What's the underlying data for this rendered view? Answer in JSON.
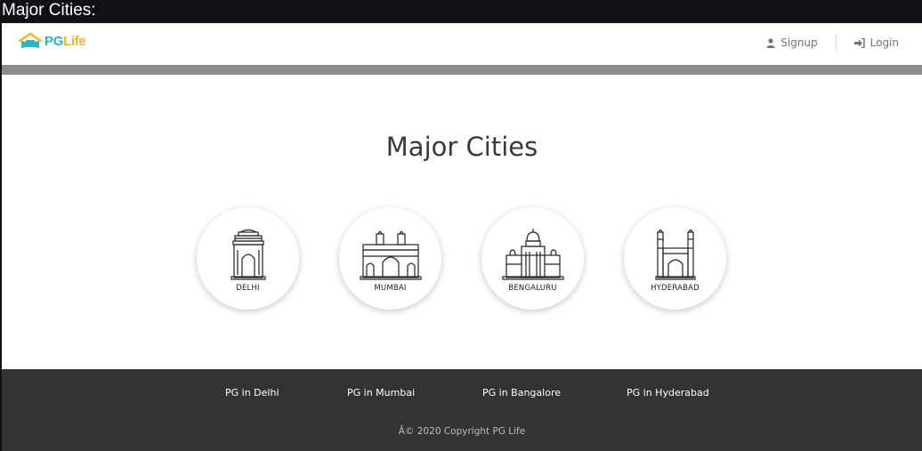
{
  "window": {
    "title": "Major Cities:"
  },
  "navbar": {
    "brand": {
      "pg": "PG",
      "life": "Life"
    },
    "signup_label": "Signup",
    "login_label": "Login"
  },
  "main": {
    "heading": "Major Cities",
    "cities": [
      {
        "label": "DELHI",
        "icon": "india-gate-icon"
      },
      {
        "label": "MUMBAI",
        "icon": "gateway-of-india-icon"
      },
      {
        "label": "BENGALURU",
        "icon": "vidhana-soudha-icon"
      },
      {
        "label": "HYDERABAD",
        "icon": "charminar-icon"
      }
    ]
  },
  "footer": {
    "links": [
      "PG in Delhi",
      "PG in Mumbai",
      "PG in Bangalore",
      "PG in Hyderabad"
    ],
    "copyright": "Â© 2020 Copyright PG Life"
  },
  "colors": {
    "brand_teal": "#2bb3c0",
    "brand_yellow": "#f3b51b",
    "footer_bg": "#333333",
    "band": "#8c8c8c"
  }
}
